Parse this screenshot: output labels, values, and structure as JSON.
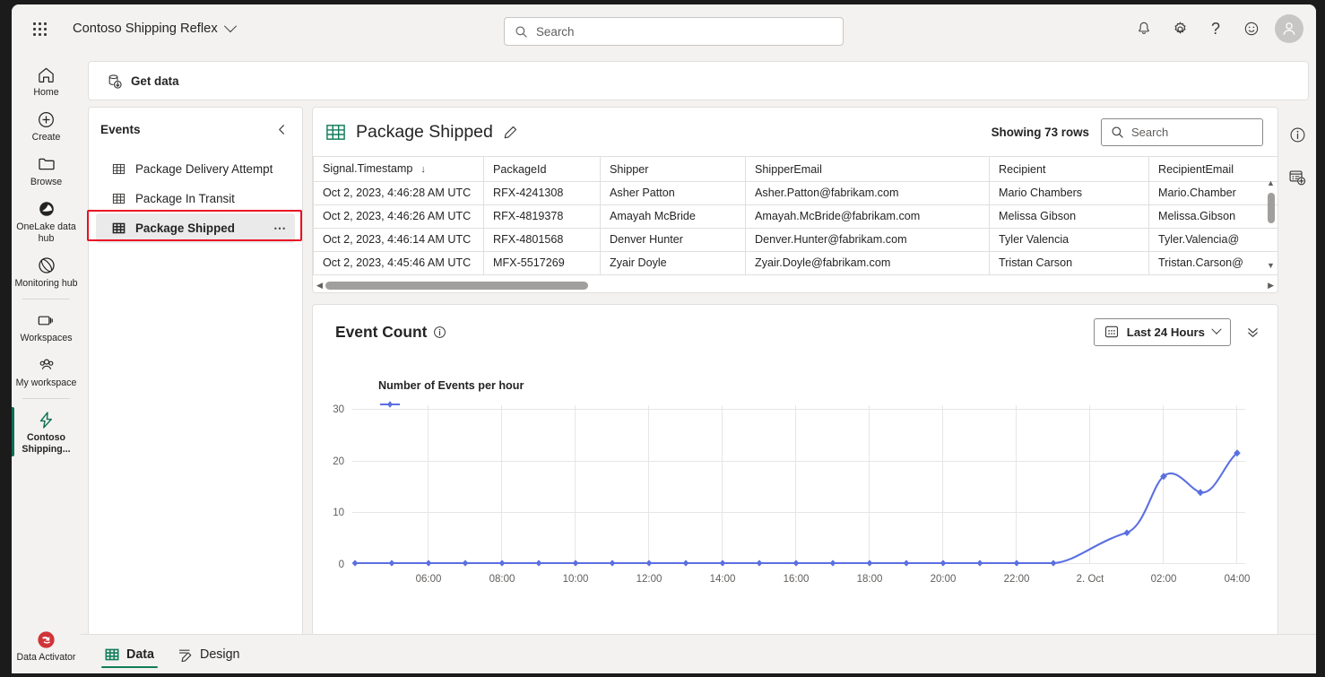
{
  "topbar": {
    "waffle_label": "app-launcher",
    "app_title": "Contoso Shipping Reflex",
    "search_placeholder": "Search",
    "icons": [
      "notifications-bell-icon",
      "settings-gear-icon",
      "help-question-icon",
      "feedback-smiley-icon"
    ],
    "avatar_label": "account-avatar"
  },
  "rail": {
    "items": [
      {
        "label": "Home",
        "icon": "home-icon",
        "active": false
      },
      {
        "label": "Create",
        "icon": "plus-circle-icon",
        "active": false
      },
      {
        "label": "Browse",
        "icon": "folder-icon",
        "active": false
      },
      {
        "label": "OneLake data hub",
        "icon": "onelake-icon",
        "active": false
      },
      {
        "label": "Monitoring hub",
        "icon": "monitoring-icon",
        "active": false
      },
      {
        "label": "Workspaces",
        "icon": "workspaces-icon",
        "active": false
      },
      {
        "label": "My workspace",
        "icon": "people-icon",
        "active": false
      },
      {
        "label": "Contoso Shipping...",
        "icon": "reflex-bolt-icon",
        "active": true
      }
    ],
    "bottom_item": {
      "label": "Data Activator",
      "icon": "data-activator-icon"
    }
  },
  "ribbon": {
    "get_data_label": "Get data",
    "get_data_icon": "get-data-icon"
  },
  "events_panel": {
    "title": "Events",
    "collapse_icon": "chevron-left-icon",
    "items": [
      {
        "label": "Package Delivery Attempt",
        "icon": "table-icon",
        "selected": false
      },
      {
        "label": "Package In Transit",
        "icon": "table-icon",
        "selected": false
      },
      {
        "label": "Package Shipped",
        "icon": "table-icon",
        "selected": true,
        "overflow": "⋯"
      }
    ]
  },
  "table_card": {
    "icon": "table-icon",
    "title": "Package Shipped",
    "edit_icon": "pencil-icon",
    "rows_label": "Showing 73 rows",
    "search_placeholder": "Search",
    "sort_column": "Signal.Timestamp",
    "sort_arrow": "↓",
    "columns": [
      "Signal.Timestamp",
      "PackageId",
      "Shipper",
      "ShipperEmail",
      "Recipient",
      "RecipientEmail"
    ],
    "rows": [
      [
        "Oct 2, 2023, 4:46:28 AM UTC",
        "RFX-4241308",
        "Asher Patton",
        "Asher.Patton@fabrikam.com",
        "Mario Chambers",
        "Mario.Chamber"
      ],
      [
        "Oct 2, 2023, 4:46:26 AM UTC",
        "RFX-4819378",
        "Amayah McBride",
        "Amayah.McBride@fabrikam.com",
        "Melissa Gibson",
        "Melissa.Gibson"
      ],
      [
        "Oct 2, 2023, 4:46:14 AM UTC",
        "RFX-4801568",
        "Denver Hunter",
        "Denver.Hunter@fabrikam.com",
        "Tyler Valencia",
        "Tyler.Valencia@"
      ],
      [
        "Oct 2, 2023, 4:45:46 AM UTC",
        "MFX-5517269",
        "Zyair Doyle",
        "Zyair.Doyle@fabrikam.com",
        "Tristan Carson",
        "Tristan.Carson@"
      ]
    ]
  },
  "chart_card": {
    "title": "Event Count",
    "info_icon": "info-circle-icon",
    "time_range_label": "Last 24 Hours",
    "time_range_icon": "calendar-icon",
    "expand_icon": "double-chevron-down-icon"
  },
  "rightrail": {
    "icons": [
      "info-circle-icon",
      "add-report-icon"
    ]
  },
  "bottom_tabs": [
    {
      "label": "Data",
      "icon": "data-grid-icon",
      "active": true
    },
    {
      "label": "Design",
      "icon": "design-pen-icon",
      "active": false
    }
  ],
  "colors": {
    "accent_green": "#107c5a",
    "line_blue": "#5b6fe0",
    "highlight_red": "#e81123",
    "chrome_gray": "#f3f2f1"
  },
  "chart_data": {
    "type": "line",
    "title": "Number of Events per hour",
    "xlabel": "",
    "ylabel": "",
    "ylim": [
      0,
      32
    ],
    "yticks": [
      0,
      10,
      20,
      30
    ],
    "grid": true,
    "legend": "Number of Events per hour",
    "legend_position": "top-left",
    "series_color": "#5b6fe0",
    "x_tick_labels": [
      "06:00",
      "08:00",
      "10:00",
      "12:00",
      "14:00",
      "16:00",
      "18:00",
      "20:00",
      "22:00",
      "2. Oct",
      "02:00",
      "04:00"
    ],
    "x": [
      "05:00",
      "06:00",
      "07:00",
      "08:00",
      "09:00",
      "10:00",
      "11:00",
      "12:00",
      "13:00",
      "14:00",
      "15:00",
      "16:00",
      "17:00",
      "18:00",
      "19:00",
      "20:00",
      "21:00",
      "22:00",
      "23:00",
      "2. Oct",
      "01:00",
      "02:00",
      "03:00",
      "04:00"
    ],
    "series": [
      {
        "name": "Number of Events per hour",
        "values": [
          0,
          0,
          0,
          0,
          0,
          0,
          0,
          0,
          0,
          0,
          0,
          0,
          0,
          0,
          0,
          0,
          0,
          0,
          0,
          0,
          6,
          17,
          14,
          20
        ]
      }
    ]
  }
}
